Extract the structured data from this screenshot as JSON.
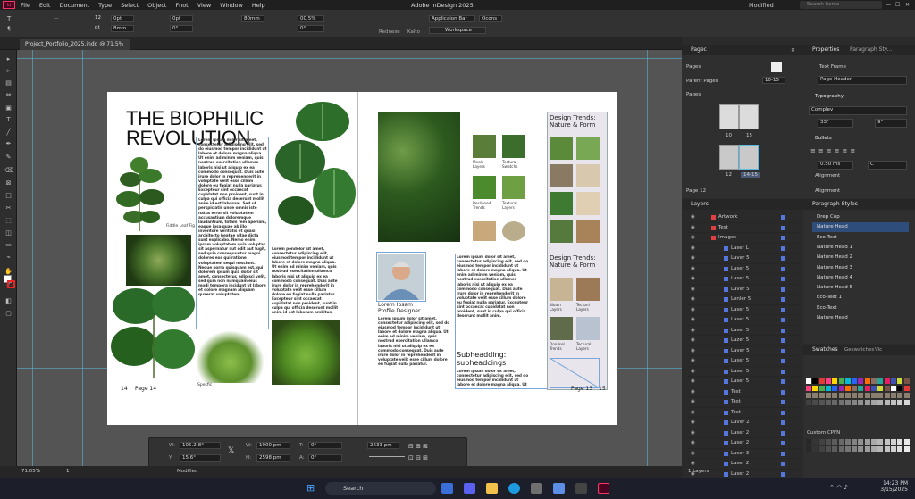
{
  "app": {
    "title": "Adobe InDesign 2025",
    "status": "Modified",
    "search_placeholder": "Search home",
    "win_min": "—",
    "win_max": "☐",
    "win_close": "✕",
    "logo": "Id"
  },
  "menu": [
    "File",
    "Edit",
    "Document",
    "Type",
    "Select",
    "Object",
    "Fnot",
    "View",
    "Window",
    "Help"
  ],
  "control": {
    "size": "12",
    "size_unit": "pt",
    "width": "80mm",
    "x_val": "0pt",
    "y_val": "8mm",
    "w2": "0pt",
    "h2": "0°",
    "pct": "00.5%",
    "angle": "0°",
    "font_style": "Applicaion Bar",
    "style2": "Ocons",
    "workspace": "Workspace",
    "tab_a": "Rednexe",
    "tab_b": "Kalto"
  },
  "document": {
    "tab": "Project_Portfolio_2025.indd @ 71.5%"
  },
  "spread": {
    "left": {
      "headline1": "THE BIOPHILIC",
      "headline2": "REVOLUTION",
      "caption1": "Fiddle Leaf Fig",
      "caption2": "Spesfic",
      "folio": "14",
      "folio_label": "Page 14",
      "body1": "Lorem ipsum dolor sit amet, consectetur adipiscing elit, sed do eiusmod tempor incididunt ut labore et dolore magna aliqua. Ut enim ad minim veniam, quis nostrud exercitation ullamco laboris nisi ut aliquip ex ea commodo consequat. Duis aute irure dolor in reprehenderit in voluptate velit esse cillum dolore eu fugiat nulla pariatur. Excepteur sint occaecat cupidatat non proident, sunt in culpa qui officia deserunt mollit anim id est laborum. Sed ut perspiciatis unde omnis iste natus error sit voluptatem accusantium doloremque laudantium, totam rem aperiam, eaque ipsa quae ab illo inventore veritatis et quasi architecto beatae vitae dicta sunt explicabo. Nemo enim ipsam voluptatem quia voluptas sit aspernatur aut odit aut fugit, sed quia consequuntur magni dolores eos qui ratione voluptatem sequi nesciunt. Neque porro quisquam est, qui dolorem ipsum quia dolor sit amet, consectetur, adipisci velit, sed quia non numquam eius modi tempora incidunt ut labore et dolore magnam aliquam quaerat voluptatem.",
      "body2": "Lorem pendolor sit amet, consectetur adipiscing elit, eiusmod tempor incididunt ut labore et dolore magna aliqua. Ut enim ad minim veniam, quis nostrud exercitation ullamco laboris nisi ut aliquip ex ea commodo consequat. Duis aute irure dolor in reprehenderit in voluptate velit esse cillum dolore eu fugiat nulla pariatur. Excepteur sint occaecat cupidatat non proident, sunt in culpa qui officia deserunt mollit anim id est laborum ambitus."
    },
    "right": {
      "sw1": "Mealc Layers",
      "sw2": "Tectural Swatchs",
      "sw3": "Beslioned Trends",
      "sw4": "Textural Layers",
      "name1": "Lorem Ipsam",
      "name2": "Profile Designer",
      "body3": "Lorem ipsum dolor sit amet, consectetur adipiscing elit, sed do eiusmod tempor incididunt ut labore et dolore magna aliqua. Ut enim ad minim veniam, quis nostrud exercitation ullamco laboris nisi ut aliquip ex ea commodo consequat. Duis aute irure dolor in reprehenderit in voluptate velit esse cillum dolore eu fugiat nulla pariatur.",
      "body4": "Lorem ipsum dolor sit amet, consectetur adipiscing elit, sed do eiusmod tempor incididunt ut labore et dolore magna aliqua. Ut enim ad minim veniam, quis nostrud exercitation ullamco laboris nisi ut aliquip ex ea commodo consequat. Duis aute irure dolor in reprehenderit in voluptate velit esse cillum dolore eu fugiat nulla pariatur. Excepteur sint occaecat cupidatat non proident, sunt in culpa qui officia deserunt mollit anim.",
      "sub1": "Subheadding:",
      "sub2": "subheadcings",
      "body5": "Lorem ipsum dolor sit amet, consectetur adipiscing elit, sed do eiusmod tempor incididunt ut labore et dolore magna aliqua. Ut enim ad minim veniam, quis nostrud exercitation ullamco.",
      "trend1a": "Design Trends:",
      "trend1b": "Nature & Form",
      "trend2a": "Design Trends:",
      "trend2b": "Nature & Form",
      "t1": "Woain Layers",
      "t2": "Tectonl Layers",
      "t3": "Donlisel Trends",
      "t4": "Tectural Layers",
      "folio_label": "Page 13",
      "folio": "15"
    }
  },
  "pages_panel": {
    "title": "Pagec",
    "tab_x": "✕",
    "pages_label": "Pages",
    "parent_label": "Parent Pages",
    "parent_val": "10-15",
    "pages2": "Pages",
    "thumb1a": "10",
    "thumb1b": "15",
    "thumb2a": "12",
    "thumb2b": "14-15",
    "page_info": "Page 12"
  },
  "properties": {
    "title": "Properties",
    "tab2": "Paragraph Sty...",
    "text_frame": "Text Frame",
    "page_header": "Page Header",
    "typography": "Typography",
    "font": "Complev",
    "size": "33°",
    "lead": "9°",
    "bullets": "Bullets",
    "indent": "0.50 ms",
    "align_c": "C",
    "alignment": "Alignment",
    "alignment2": "Alignment"
  },
  "layers_panel": {
    "title": "Layers",
    "footer": "1 Layers",
    "rows": [
      "Artwork",
      "Test",
      "Images",
      "Laser L",
      "Laver 5",
      "Laser 5",
      "Laser 5",
      "Laver 5",
      "Lonler 5",
      "Laser 5",
      "Laser 5",
      "Laser 5",
      "Lazer 5",
      "Laver 5",
      "Laser 5",
      "Laser 5",
      "Laser 5",
      "Test",
      "Test",
      "Test",
      "Laver 2",
      "Laser 2",
      "Laser 2",
      "Laser 3",
      "Laser 2",
      "Laser 2"
    ]
  },
  "para_styles": {
    "title": "Paragraph Styles",
    "items": [
      "Drep Cop",
      "Nature Head",
      "Eco-Text",
      "Nature Head 1",
      "Nature Head 2",
      "Nature Head 3",
      "Nature Head 4",
      "Nature Head 5",
      "Eco-Teet 1",
      "Eco-Text",
      "Nature Head"
    ]
  },
  "swatches": {
    "tab1": "Swatches",
    "tab2": "Geswatches",
    "tab3": "Vic",
    "custom": "Custom CPFN"
  },
  "status": {
    "zoom": "71.05%",
    "page": "1",
    "state": "Modified"
  },
  "transform": {
    "w": "105.2-8°",
    "h": "15.6°",
    "x": "1900 pm",
    "y": "2598 pm",
    "t": "0°",
    "a": "0°",
    "ref": "2633 pm"
  },
  "taskbar": {
    "search": "Search",
    "time": "14:23 PM",
    "date": "3/15/2025"
  },
  "colors": {
    "accent": "#ff3366",
    "guide": "#5bbbe0",
    "frame": "#7aa6d8",
    "canvas": "#545454"
  }
}
